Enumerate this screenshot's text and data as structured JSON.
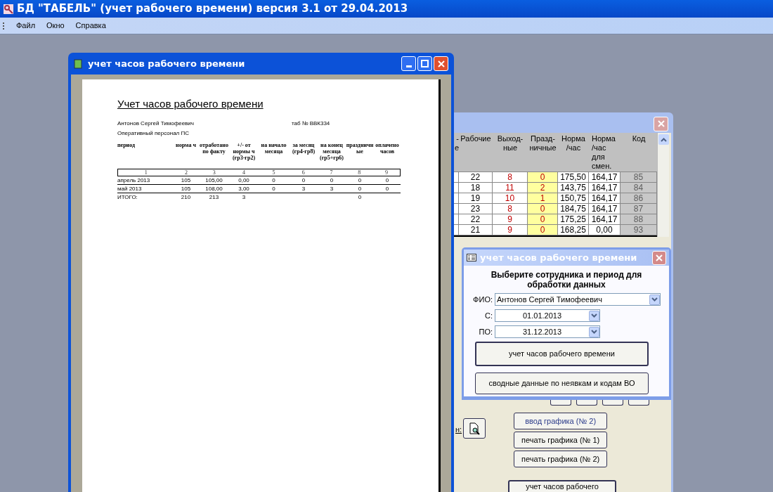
{
  "app": {
    "title": "БД \"ТАБЕЛЬ\" (учет рабочего времени) версия 3.1 от 29.04.2013",
    "menu": [
      "Файл",
      "Окно",
      "Справка"
    ]
  },
  "report_window": {
    "title": "учет часов рабочего времени",
    "report": {
      "heading": "Учет часов рабочего времени",
      "employee": "Антонов Сергей Тимофеевич",
      "tab_number": "таб № ВВК334",
      "department": "Оперативный персонал ПС",
      "columns": [
        "период",
        "норма ч",
        "отработано по факту",
        "+/- от нормы ч (гр3-гр2)",
        "на начало месяца",
        "за месяц (гр4-гр8)",
        "на конец месяца (гр5+гр6)",
        "праздничные",
        "оплачено часов"
      ],
      "column_numbers": [
        "1",
        "2",
        "3",
        "4",
        "5",
        "6",
        "7",
        "8",
        "9"
      ],
      "rows": [
        [
          "апрель 2013",
          "105",
          "105,00",
          "0,00",
          "0",
          "0",
          "0",
          "0",
          "0"
        ],
        [
          "май 2013",
          "105",
          "108,00",
          "3,00",
          "0",
          "3",
          "3",
          "0",
          "0"
        ]
      ],
      "total": {
        "period": "ИТОГО:",
        "norm": "210",
        "worked": "213",
        "difference": "3",
        "holidays": "0"
      }
    }
  },
  "back_window": {
    "partial_header": {
      "lines": [
        "-",
        "е"
      ]
    },
    "columns": [
      {
        "lines": [
          "Рабочие"
        ]
      },
      {
        "lines": [
          "Выход-",
          "ные"
        ]
      },
      {
        "lines": [
          "Празд-",
          "ничные"
        ]
      },
      {
        "lines": [
          "Норма",
          "/час"
        ]
      },
      {
        "lines": [
          "Норма",
          "/час",
          "для",
          "смен."
        ]
      },
      {
        "lines": [
          "Код"
        ]
      }
    ],
    "rows": [
      [
        "22",
        "8",
        "0",
        "175,50",
        "164,17",
        "85"
      ],
      [
        "18",
        "11",
        "2",
        "143,75",
        "164,17",
        "84"
      ],
      [
        "19",
        "10",
        "1",
        "150,75",
        "164,17",
        "86"
      ],
      [
        "23",
        "8",
        "0",
        "184,75",
        "164,17",
        "87"
      ],
      [
        "22",
        "9",
        "0",
        "175,25",
        "164,17",
        "88"
      ],
      [
        "21",
        "9",
        "0",
        "168,25",
        "0,00",
        "93"
      ]
    ],
    "label_fragment": "н:",
    "buttons": [
      "ввод графика (№ 2)",
      "печать графика (№ 1)",
      "печать графика (№ 2)"
    ],
    "bottom_button": "учет часов рабочего"
  },
  "dialog": {
    "title": "учет часов рабочего времени",
    "prompt": "Выберите сотрудника и период для обработки данных",
    "fields": [
      {
        "label": "ФИО:",
        "value": "Антонов Сергей Тимофеевич"
      },
      {
        "label": "С:",
        "value": "01.01.2013"
      },
      {
        "label": "ПО:",
        "value": "31.12.2013"
      }
    ],
    "buttons": [
      "учет часов рабочего времени",
      "сводные данные по неявкам и кодам ВО"
    ]
  }
}
